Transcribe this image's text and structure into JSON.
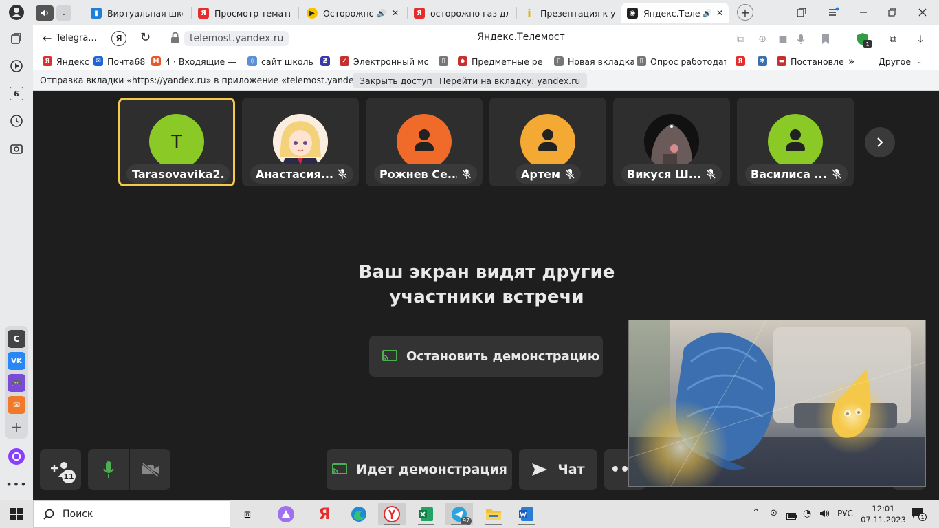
{
  "browser": {
    "tabs": [
      {
        "title": "Виртуальная школ",
        "color": "#1f7fd6",
        "glyph": "▮"
      },
      {
        "title": "Просмотр тематич",
        "color": "#e42d2d",
        "glyph": "Я"
      },
      {
        "title": "Осторожно г",
        "color": "#f5c400",
        "glyph": "▶"
      },
      {
        "title": "осторожно газ для",
        "color": "#e42d2d",
        "glyph": "Я"
      },
      {
        "title": "Презентация к уро",
        "color": "#f5c400",
        "glyph": "i"
      },
      {
        "title": "Яндекс.Телем",
        "color": "#222222",
        "glyph": "◉"
      }
    ],
    "new_tab_symbol": "+",
    "back_label": "Telegra...",
    "yandex_btn": "Я",
    "url": "telemost.yandex.ru",
    "page_title": "Яндекс.Телемост",
    "extension_badge": "1",
    "bookmarks": [
      {
        "label": "Яндекс",
        "color": "#e42d2d",
        "glyph": "Я"
      },
      {
        "label": "Почта68",
        "color": "#1f66d6",
        "glyph": "✉"
      },
      {
        "label": "4 · Входящие — Я",
        "color": "#e8572a",
        "glyph": "М"
      },
      {
        "label": "сайт школы",
        "color": "#5b8fd8",
        "glyph": "◊"
      },
      {
        "label": "",
        "color": "#3b3ba8",
        "glyph": "Ƶ"
      },
      {
        "label": "Электронный мон",
        "color": "#c8302f",
        "glyph": "✓"
      },
      {
        "label": "",
        "color": "#777777",
        "glyph": "▯"
      },
      {
        "label": "Предметные резу",
        "color": "#c8302f",
        "glyph": "◆"
      },
      {
        "label": "Новая вкладка",
        "color": "#777777",
        "glyph": "▯"
      },
      {
        "label": "Опрос работодате",
        "color": "#777777",
        "glyph": "▯"
      },
      {
        "label": "",
        "color": "#e42d2d",
        "glyph": "Я"
      },
      {
        "label": "",
        "color": "#3b6fb0",
        "glyph": "✱"
      },
      {
        "label": "Постановле",
        "color": "#c8302f",
        "glyph": "▬"
      }
    ],
    "bookmarks_more": "»",
    "bookmarks_other": "Другое",
    "info_bar": {
      "text": "Отправка вкладки «https://yandex.ru» в приложение «telemost.yandex.ru»...",
      "close_access": "Закрыть доступ",
      "go_to_tab": "Перейти на вкладку: yandex.ru"
    }
  },
  "sidebar_apps": [
    {
      "label": "С",
      "color": "#444444"
    },
    {
      "label": "VK",
      "color": "#2787f5"
    },
    {
      "label": "🎮",
      "color": "#7a4bd6"
    },
    {
      "label": "✉",
      "color": "#f07a2a"
    }
  ],
  "sidebar_badge": "6",
  "telemost": {
    "participants": [
      {
        "name": "Tarasovavika2...",
        "initial": "T",
        "color": "#8ac926",
        "avatar": "letter",
        "muted": false,
        "active": true
      },
      {
        "name": "Анастасия...",
        "initial": "",
        "color": "#f2e6da",
        "avatar": "photo-anime",
        "muted": true,
        "active": false
      },
      {
        "name": "Рожнев Се...",
        "initial": "",
        "color": "#f06a2a",
        "avatar": "default",
        "muted": true,
        "active": false
      },
      {
        "name": "Артем",
        "initial": "",
        "color": "#f4a934",
        "avatar": "default",
        "muted": true,
        "active": false
      },
      {
        "name": "Викуся Ш...",
        "initial": "",
        "color": "#3a2e2e",
        "avatar": "photo-dark",
        "muted": true,
        "active": false
      },
      {
        "name": "Василиса ...",
        "initial": "",
        "color": "#8ac926",
        "avatar": "default",
        "muted": true,
        "active": false
      }
    ],
    "share_message": "Ваш экран видят другие участники встречи",
    "stop_demo": "Остановить демонстрацию",
    "participants_count": "11",
    "demo_in_progress": "Идет демонстрация",
    "chat": "Чат",
    "accent_green": "#4caf50",
    "active_border": "#f7c948"
  },
  "taskbar": {
    "search_placeholder": "Поиск",
    "telegram_badge": "97",
    "lang": "РУС",
    "time": "12:01",
    "date": "07.11.2023",
    "notify_count": "1"
  }
}
